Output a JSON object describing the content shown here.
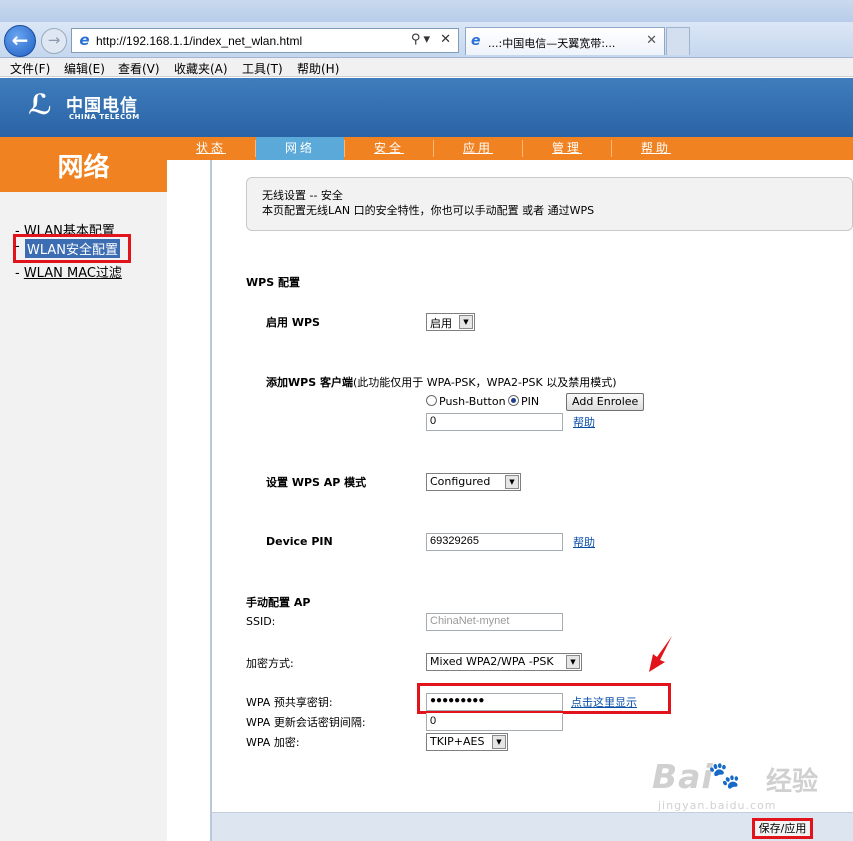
{
  "browser": {
    "url": "http://192.168.1.1/index_net_wlan.html",
    "tab_title": "...:中国电信—天翼宽带:...",
    "menu": [
      "文件(F)",
      "编辑(E)",
      "查看(V)",
      "收藏夹(A)",
      "工具(T)",
      "帮助(H)"
    ]
  },
  "header": {
    "logo_cn": "中国电信",
    "logo_en": "CHINA TELECOM"
  },
  "section": {
    "title": "网络"
  },
  "top_tabs": [
    {
      "label": "状态",
      "active": false
    },
    {
      "label": "网络",
      "active": true
    },
    {
      "label": "安全",
      "active": false
    },
    {
      "label": "应用",
      "active": false
    },
    {
      "label": "管理",
      "active": false
    },
    {
      "label": "帮助",
      "active": false
    }
  ],
  "left_nav": [
    {
      "prefix": "- ",
      "label": "WLAN基本配置",
      "active": false
    },
    {
      "prefix": "- ",
      "label": "WLAN安全配置",
      "active": true
    },
    {
      "prefix": "- ",
      "label": "WLAN MAC过滤",
      "active": false
    }
  ],
  "info": {
    "title": "无线设置 -- 安全",
    "desc": "本页配置无线LAN 口的安全特性，你也可以手动配置 或者 通过WPS"
  },
  "wps": {
    "heading": "WPS 配置",
    "enable_label": "启用 WPS",
    "enable_value": "启用",
    "add_client_label_bold": "添加WPS 客户端",
    "add_client_label_note": "(此功能仅用于 WPA-PSK，WPA2-PSK 以及禁用模式)",
    "radio_push": "Push-Button",
    "radio_pin": "PIN",
    "selected_mode": "PIN",
    "add_enrolee_btn": "Add Enrolee",
    "pin_value": "0",
    "help_link": "帮助",
    "ap_mode_label": "设置 WPS AP 模式",
    "ap_mode_value": "Configured",
    "device_pin_label": "Device PIN",
    "device_pin_value": "69329265",
    "help_link2": "帮助"
  },
  "manual": {
    "heading": "手动配置 AP",
    "ssid_label": "SSID:",
    "ssid_value": "ChinaNet-mynet",
    "enc_label": "加密方式:",
    "enc_value": "Mixed WPA2/WPA -PSK",
    "psk_label": "WPA 预共享密钥:",
    "psk_value": "●●●●●●●●●",
    "show_link": "点击这里显示",
    "rekey_label": "WPA 更新会话密钥间隔:",
    "rekey_value": "0",
    "cipher_label": "WPA 加密:",
    "cipher_value": "TKIP+AES"
  },
  "footer": {
    "save_btn": "保存/应用"
  },
  "watermark": {
    "brand": "Bai",
    "cn": "经验",
    "url": "jingyan.baidu.com"
  }
}
